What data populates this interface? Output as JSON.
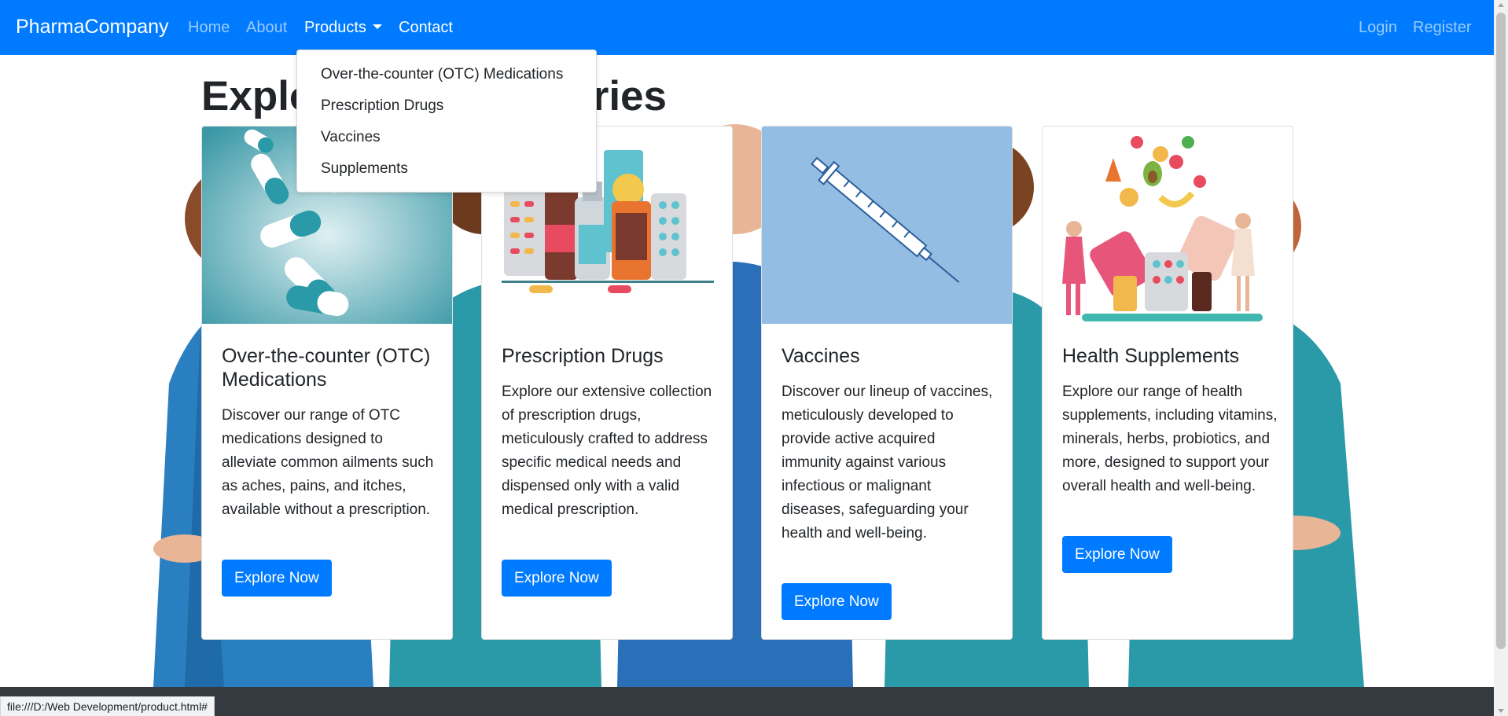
{
  "colors": {
    "primary": "#007bff",
    "footer": "#343a40",
    "scrub_teal": "#2a9aa8",
    "scrub_blue": "#2a6fb8"
  },
  "navbar": {
    "brand": "PharmaCompany",
    "links": [
      {
        "label": "Home",
        "active": false
      },
      {
        "label": "About",
        "active": false
      },
      {
        "label": "Products",
        "active": true,
        "dropdown": true
      },
      {
        "label": "Contact",
        "active": true
      }
    ],
    "right": [
      {
        "label": "Login"
      },
      {
        "label": "Register"
      }
    ]
  },
  "dropdown": {
    "items": [
      "Over-the-counter (OTC) Medications",
      "Prescription Drugs",
      "Vaccines",
      "Supplements"
    ]
  },
  "heading": "Explore Our Categories",
  "cards": [
    {
      "title": "Over-the-counter (OTC) Medications",
      "text": "Discover our range of OTC medications designed to alleviate common ailments such as aches, pains, and itches, available without a prescription.",
      "button": "Explore Now",
      "image_icon": "capsules-icon"
    },
    {
      "title": "Prescription Drugs",
      "text": "Explore our extensive collection of prescription drugs, meticulously crafted to address specific medical needs and dispensed only with a valid medical prescription.",
      "button": "Explore Now",
      "image_icon": "medicine-bottles-icon"
    },
    {
      "title": "Vaccines",
      "text": "Discover our lineup of vaccines, meticulously developed to provide active acquired immunity against various infectious or malignant diseases, safeguarding your health and well-being.",
      "button": "Explore Now",
      "image_icon": "syringe-icon"
    },
    {
      "title": "Health Supplements",
      "text": "Explore our range of health supplements, including vitamins, minerals, herbs, probiotics, and more, designed to support your overall health and well-being.",
      "button": "Explore Now",
      "image_icon": "supplements-icon"
    }
  ],
  "status_bar": "file:///D:/Web Development/product.html#"
}
